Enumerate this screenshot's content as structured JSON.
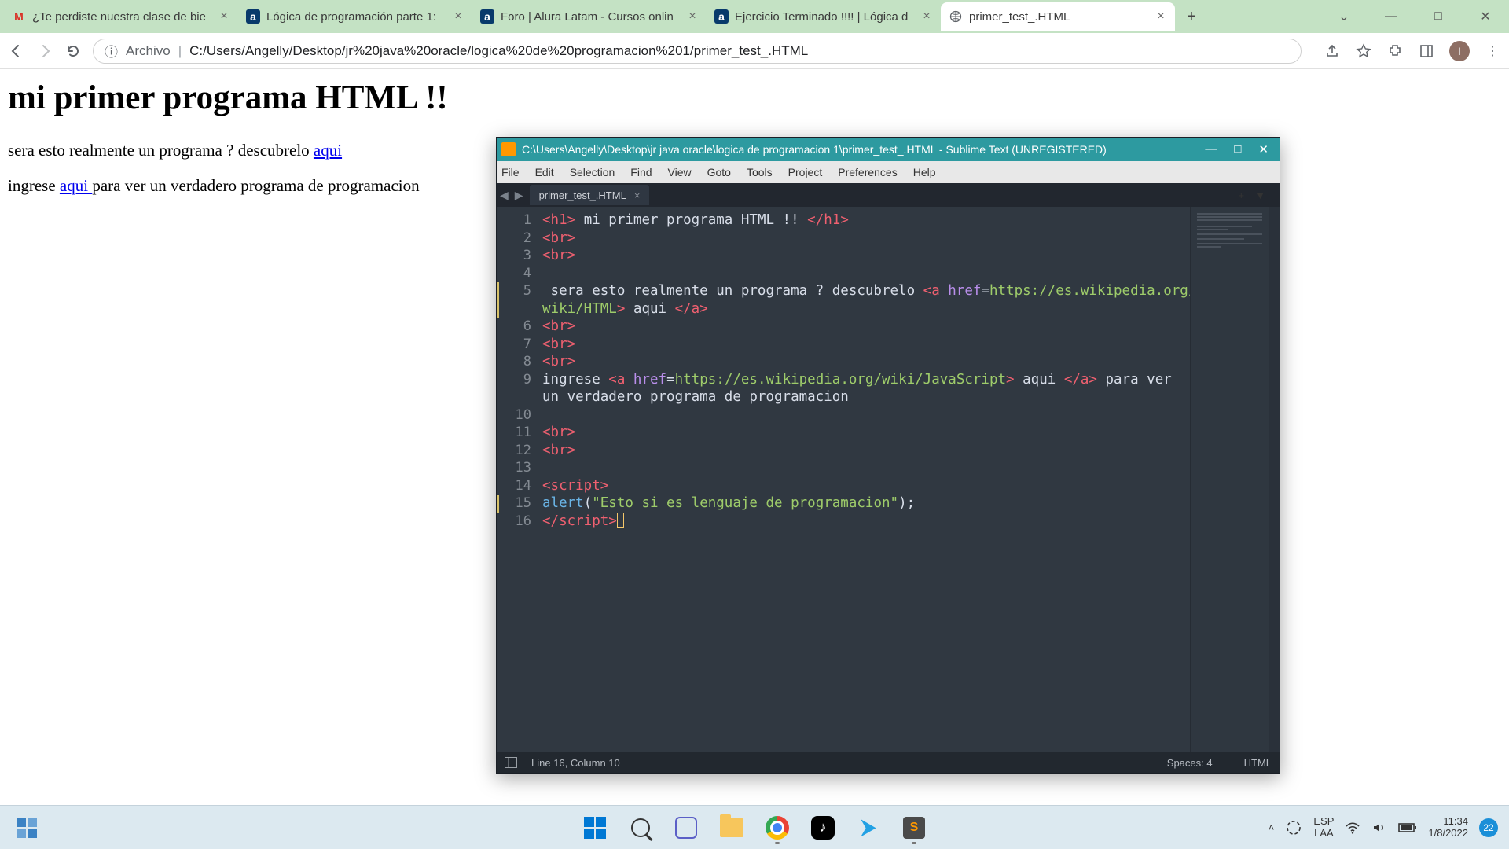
{
  "chrome": {
    "tabs": [
      {
        "title": "¿Te perdiste nuestra clase de bie",
        "icon": "gmail"
      },
      {
        "title": "Lógica de programación parte 1:",
        "icon": "a"
      },
      {
        "title": "Foro | Alura Latam - Cursos onlin",
        "icon": "a"
      },
      {
        "title": "Ejercicio Terminado !!!! | Lógica d",
        "icon": "a"
      },
      {
        "title": "primer_test_.HTML",
        "icon": "globe",
        "active": true
      }
    ],
    "addr_prefix": "Archivo",
    "url": "C:/Users/Angelly/Desktop/jr%20java%20oracle/logica%20de%20programacion%201/primer_test_.HTML"
  },
  "page": {
    "h1": "mi primer programa HTML !!",
    "line1_a": "sera esto realmente un programa ? descubrelo ",
    "line1_link": "aqui",
    "line2_a": "ingrese ",
    "line2_link": "aqui ",
    "line2_b": "para ver un verdadero programa de programacion"
  },
  "sublime": {
    "title": "C:\\Users\\Angelly\\Desktop\\jr java oracle\\logica de programacion 1\\primer_test_.HTML - Sublime Text (UNREGISTERED)",
    "menu": [
      "File",
      "Edit",
      "Selection",
      "Find",
      "View",
      "Goto",
      "Tools",
      "Project",
      "Preferences",
      "Help"
    ],
    "file_tab": "primer_test_.HTML",
    "code": {
      "l1": {
        "o": "<h1>",
        "t": " mi primer programa HTML !! ",
        "c": "</h1>"
      },
      "l2": "<br>",
      "l3": "<br>",
      "l5a": " sera esto realmente un programa ? descubrelo ",
      "l5_open": "<a",
      "l5_attr": " href",
      "l5_eq": "=",
      "l5_url": "https://es.wikipedia.org/",
      "l5w_url": "wiki/HTML",
      "l5w_close": ">",
      "l5w_text": " aqui ",
      "l5w_end": "</a>",
      "l6": "<br>",
      "l7": "<br>",
      "l8": "<br>",
      "l9a": "ingrese ",
      "l9_open": "<a",
      "l9_attr": " href",
      "l9_eq": "=",
      "l9_url": "https://es.wikipedia.org/wiki/JavaScript",
      "l9_close": ">",
      "l9_text": " aqui ",
      "l9_end": "</a>",
      "l9b": " para ver",
      "l9w": "un verdadero programa de programacion",
      "l11": "<br>",
      "l12": "<br>",
      "l14o": "<script",
      "l14c": ">",
      "l15f": "alert",
      "l15p": "(",
      "l15s": "\"Esto si es lenguaje de programacion\"",
      "l15e": ");",
      "l16o": "</script",
      "l16c": ">"
    },
    "status_left": "Line 16, Column 10",
    "status_spaces": "Spaces: 4",
    "status_lang": "HTML"
  },
  "taskbar": {
    "lang1": "ESP",
    "lang2": "LAA",
    "time": "11:34",
    "date": "1/8/2022",
    "notif": "22"
  }
}
